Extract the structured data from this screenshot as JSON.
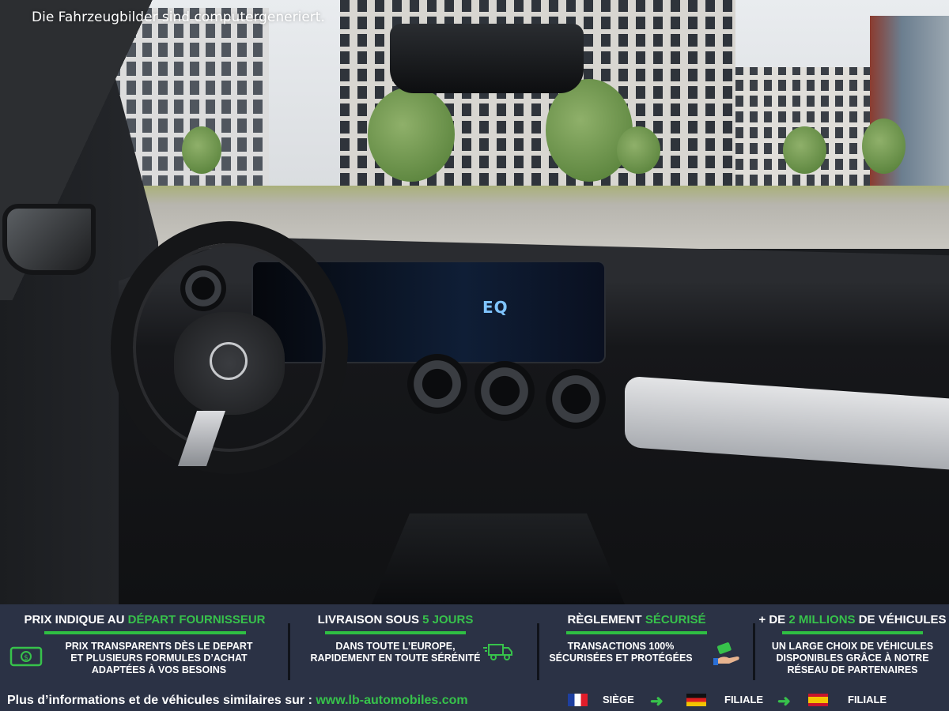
{
  "photo": {
    "disclaimer": "Die Fahrzeugbilder sind computergeneriert.",
    "screen_badge": "EQ"
  },
  "features": [
    {
      "title_prefix": "PRIX INDIQUE AU ",
      "title_highlight": "DÉPART FOURNISSEUR",
      "title_suffix": "",
      "body": [
        "PRIX TRANSPARENTS DÈS LE DEPART",
        "ET PLUSIEURS FORMULES D’ACHAT",
        "ADAPTÉES À VOS BESOINS"
      ],
      "icon": "money-bill-icon"
    },
    {
      "title_prefix": "LIVRAISON SOUS ",
      "title_highlight": "5 JOURS",
      "title_suffix": "",
      "body": [
        "DANS TOUTE L’EUROPE,",
        "RAPIDEMENT EN TOUTE SÉRÉNITÉ"
      ],
      "icon": "delivery-truck-icon"
    },
    {
      "title_prefix": "RÈGLEMENT ",
      "title_highlight": "SÉCURISÉ",
      "title_suffix": "",
      "body": [
        "TRANSACTIONS 100%",
        "SÉCURISÉES ET PROTÉGÉES"
      ],
      "icon": "payment-hand-icon"
    },
    {
      "title_prefix": "+ DE ",
      "title_highlight": "2 MILLIONS",
      "title_suffix": " DE VÉHICULES",
      "body": [
        "UN LARGE CHOIX DE VÉHICULES",
        "DISPONIBLES GRÂCE À NOTRE",
        "RÉSEAU DE PARTENAIRES"
      ],
      "icon": ""
    }
  ],
  "footer": {
    "info_text": "Plus d’informations et de véhicules similaires sur : ",
    "url": "www.lb-automobiles.com",
    "locations": [
      {
        "flag": "france-flag-icon",
        "label": "SIÈGE"
      },
      {
        "flag": "germany-flag-icon",
        "label": "FILIALE"
      },
      {
        "flag": "spain-flag-icon",
        "label": "FILIALE"
      }
    ]
  },
  "colors": {
    "banner_bg": "#2b3245",
    "accent_green": "#37c24b"
  }
}
